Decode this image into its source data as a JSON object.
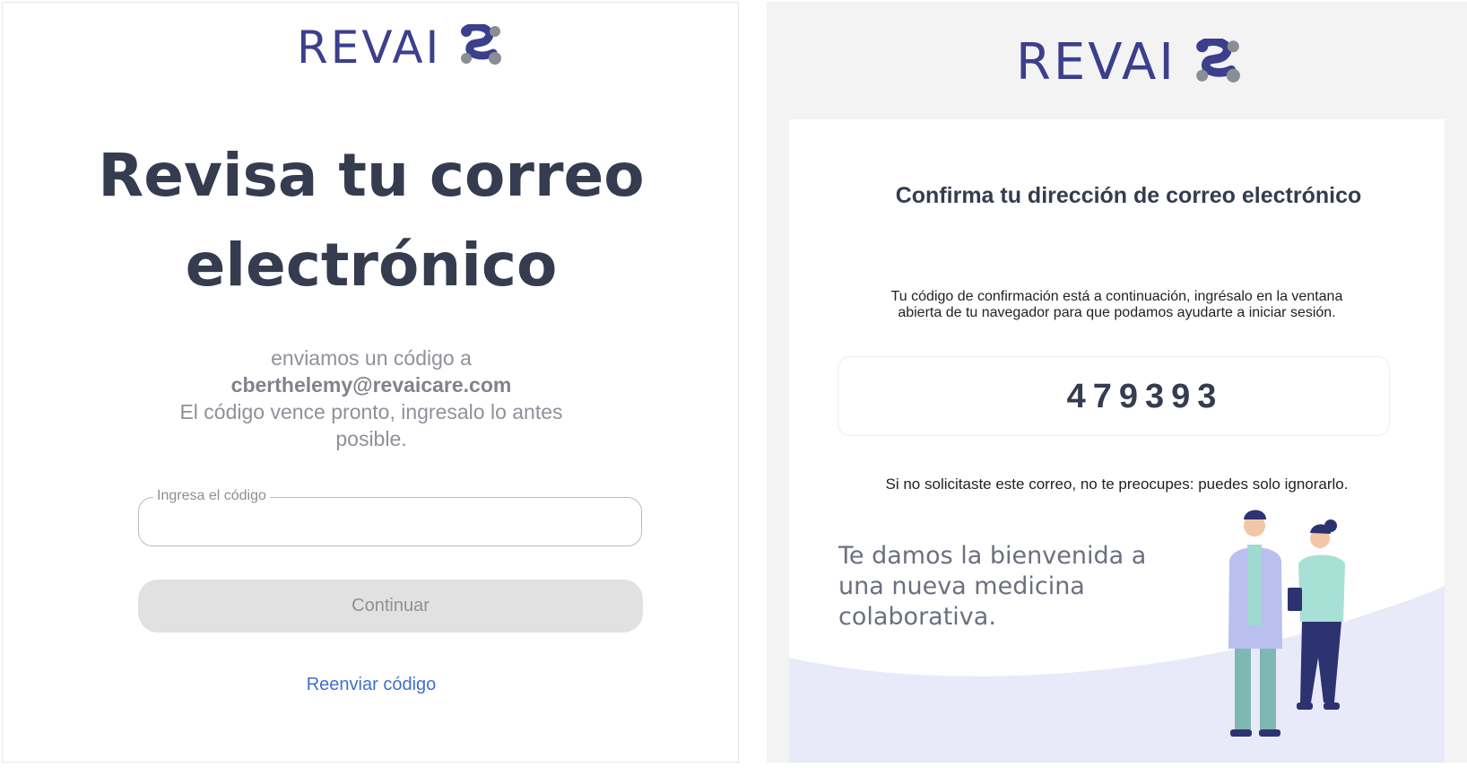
{
  "left": {
    "brand": "REVAI",
    "headline_line1": "Revisa tu correo",
    "headline_line2": "electrónico",
    "sent_text": "enviamos un código a",
    "email": "cberthelemy@revaicare.com",
    "expiry_line1": "El código vence pronto, ingresalo lo antes",
    "expiry_line2": "posible.",
    "code_field_label": "Ingresa el código",
    "code_field_value": "",
    "continue_label": "Continuar",
    "resend_label": "Reenviar código"
  },
  "right": {
    "brand": "REVAI",
    "title": "Confirma tu dirección de correo electrónico",
    "body_line1": "Tu código de confirmación está a continuación, ingrésalo en la ventana",
    "body_line2": "abierta de tu navegador para que podamos ayudarte a iniciar sesión.",
    "code": "479393",
    "ignore_text": "Si no solicitaste este correo, no te preocupes: puedes solo ignorarlo.",
    "welcome_line1": "Te damos la bienvenida a",
    "welcome_line2": "una nueva medicina",
    "welcome_line3": "colaborativa."
  },
  "colors": {
    "brand": "#3b3f8c",
    "heading": "#353c4f",
    "link": "#3f6fd0",
    "button_disabled": "#e1e1e1"
  },
  "icons": [
    "revai-logo-icon",
    "doctor-illustration",
    "nurse-illustration"
  ]
}
